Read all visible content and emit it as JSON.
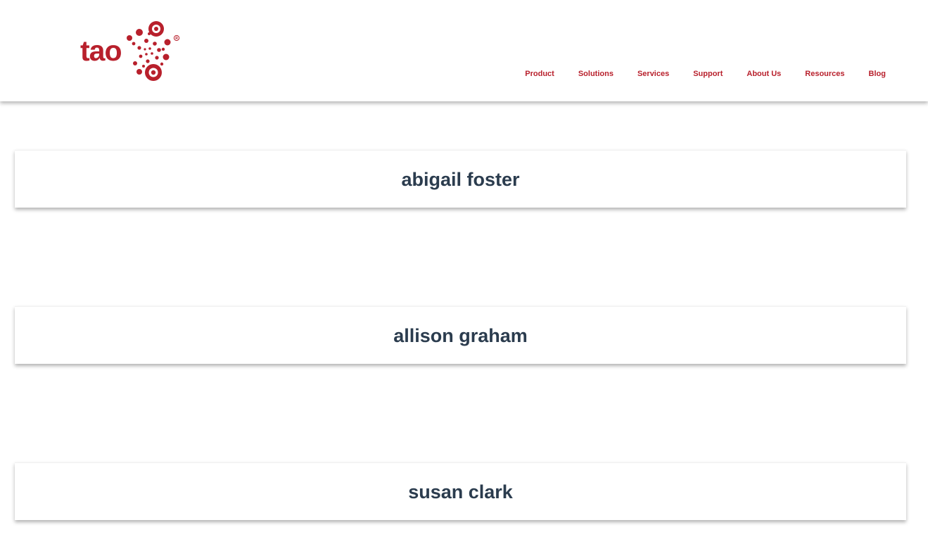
{
  "brand": {
    "logo_text": "tao",
    "registered_mark": "®",
    "logo_icon": "tao-burst-logo-icon",
    "color": "#b8202c"
  },
  "nav": {
    "items": [
      {
        "label": "Product"
      },
      {
        "label": "Solutions"
      },
      {
        "label": "Services"
      },
      {
        "label": "Support"
      },
      {
        "label": "About Us"
      },
      {
        "label": "Resources"
      },
      {
        "label": "Blog"
      }
    ]
  },
  "people": [
    {
      "name": "abigail foster"
    },
    {
      "name": "allison graham"
    },
    {
      "name": "susan clark"
    }
  ],
  "colors": {
    "brand": "#b8202c",
    "title": "#2b3c4e",
    "background": "#ffffff"
  }
}
